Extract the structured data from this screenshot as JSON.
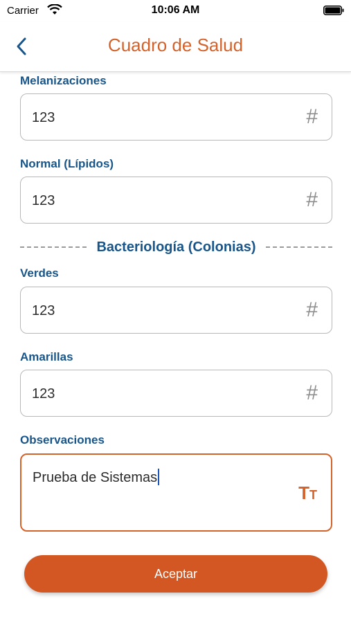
{
  "status_bar": {
    "carrier": "Carrier",
    "time": "10:06 AM",
    "icons": [
      "wifi-icon",
      "battery-icon"
    ]
  },
  "nav": {
    "title": "Cuadro de Salud",
    "back_icon": "chevron-left-icon"
  },
  "form": {
    "melanizaciones": {
      "label": "Melanizaciones",
      "value": "123",
      "icon": "#"
    },
    "normal_lipidos": {
      "label": "Normal (Lípidos)",
      "value": "123",
      "icon": "#"
    },
    "section_title": "Bacteriología (Colonias)",
    "verdes": {
      "label": "Verdes",
      "value": "123",
      "icon": "#"
    },
    "amarillas": {
      "label": "Amarillas",
      "value": "123",
      "icon": "#"
    },
    "observaciones": {
      "label": "Observaciones",
      "value": "Prueba de Sistemas",
      "icon_big": "T",
      "icon_small": "T"
    }
  },
  "accept_button": "Aceptar",
  "colors": {
    "accent": "#d4632b",
    "button": "#d25722",
    "label": "#17558a"
  }
}
